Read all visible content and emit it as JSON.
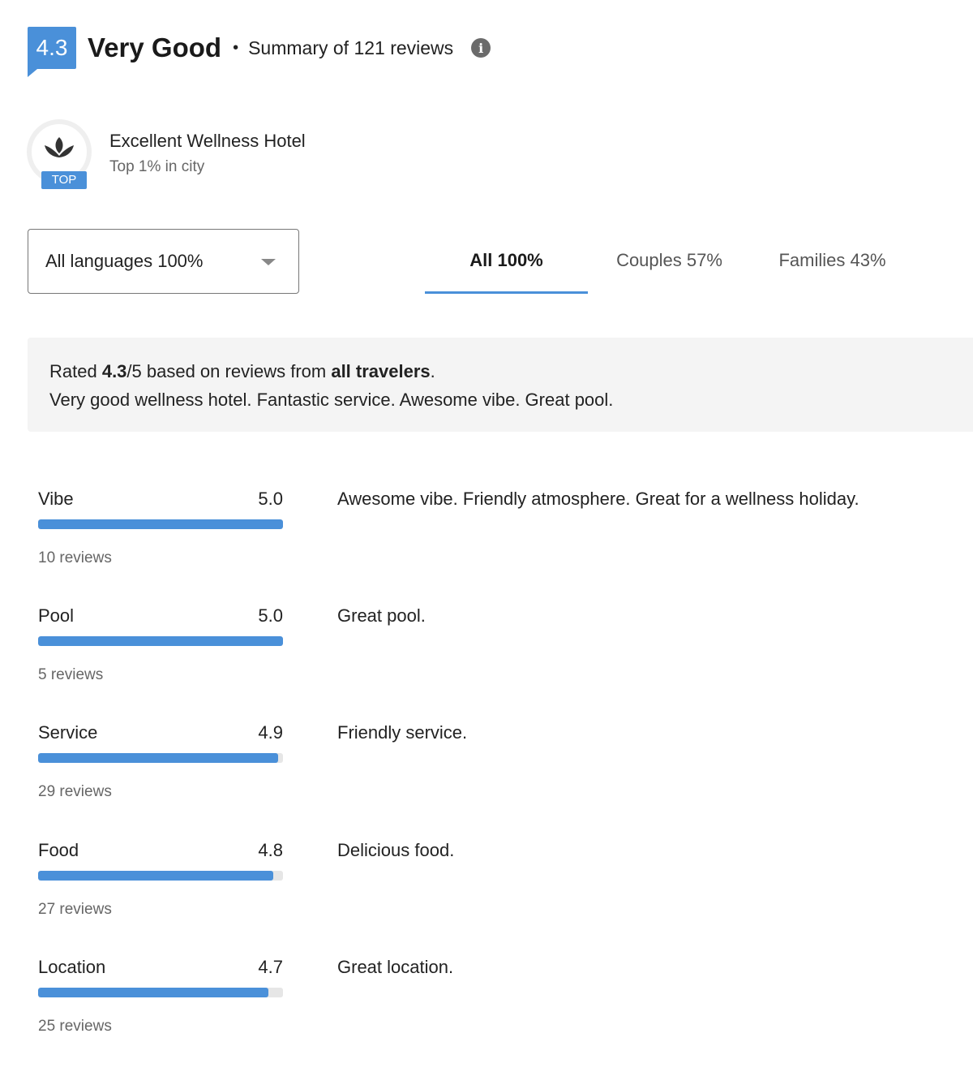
{
  "header": {
    "score": "4.3",
    "rating_label": "Very Good",
    "bullet": "•",
    "summary": "Summary of 121 reviews",
    "info_icon": "info-icon"
  },
  "award": {
    "tag": "TOP",
    "title": "Excellent Wellness Hotel",
    "subtitle": "Top 1% in city",
    "icon": "lotus-icon"
  },
  "filters": {
    "language": "All languages 100%",
    "tabs": [
      {
        "label": "All 100%",
        "active": true
      },
      {
        "label": "Couples 57%",
        "active": false
      },
      {
        "label": "Families 43%",
        "active": false
      }
    ]
  },
  "summary_box": {
    "prefix": "Rated ",
    "score": "4.3",
    "mid": "/5 based on reviews from ",
    "travelers": "all travelers",
    "suffix": ".",
    "line2": "Very good wellness hotel. Fantastic service. Awesome vibe. Great pool."
  },
  "categories": [
    {
      "name": "Vibe",
      "score": "5.0",
      "fraction": 1.0,
      "reviews": "10 reviews",
      "description": "Awesome vibe. Friendly atmosphere. Great for a wellness holiday."
    },
    {
      "name": "Pool",
      "score": "5.0",
      "fraction": 1.0,
      "reviews": "5 reviews",
      "description": "Great pool."
    },
    {
      "name": "Service",
      "score": "4.9",
      "fraction": 0.98,
      "reviews": "29 reviews",
      "description": "Friendly service."
    },
    {
      "name": "Food",
      "score": "4.8",
      "fraction": 0.96,
      "reviews": "27 reviews",
      "description": "Delicious food."
    },
    {
      "name": "Location",
      "score": "4.7",
      "fraction": 0.94,
      "reviews": "25 reviews",
      "description": "Great location."
    }
  ],
  "colors": {
    "accent": "#4a90d9",
    "bar_track": "#e6e6e6",
    "summary_bg": "#f4f4f4"
  }
}
